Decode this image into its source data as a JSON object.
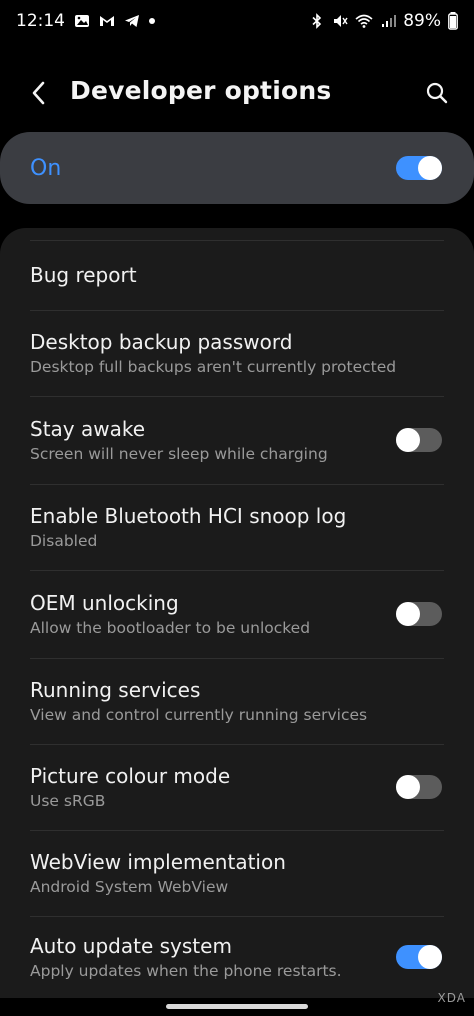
{
  "status": {
    "time": "12:14",
    "battery": "89%",
    "left_icons": [
      "gallery-icon",
      "gmail-icon",
      "telegram-icon",
      "dot-icon"
    ],
    "right_icons": [
      "bluetooth-icon",
      "mute-icon",
      "wifi-icon",
      "signal-icon"
    ]
  },
  "header": {
    "title": "Developer options",
    "back_icon": "chevron-left-icon",
    "search_icon": "search-icon"
  },
  "master": {
    "label": "On",
    "enabled": true
  },
  "items": [
    {
      "title": "Bug report",
      "subtitle": "",
      "toggle": null
    },
    {
      "title": "Desktop backup password",
      "subtitle": "Desktop full backups aren't currently protected",
      "toggle": null
    },
    {
      "title": "Stay awake",
      "subtitle": "Screen will never sleep while charging",
      "toggle": false
    },
    {
      "title": "Enable Bluetooth HCI snoop log",
      "subtitle": "Disabled",
      "toggle": null
    },
    {
      "title": "OEM unlocking",
      "subtitle": "Allow the bootloader to be unlocked",
      "toggle": false
    },
    {
      "title": "Running services",
      "subtitle": "View and control currently running services",
      "toggle": null
    },
    {
      "title": "Picture colour mode",
      "subtitle": "Use sRGB",
      "toggle": false
    },
    {
      "title": "WebView implementation",
      "subtitle": "Android System WebView",
      "toggle": null
    },
    {
      "title": "Auto update system",
      "subtitle": "Apply updates when the phone restarts.",
      "toggle": true
    }
  ],
  "watermark": "XDA",
  "colors": {
    "accent": "#3e91ff",
    "card": "#1b1b1b",
    "master_card": "#3b3d42",
    "background": "#000000",
    "toggle_off": "#5c5c5c"
  }
}
